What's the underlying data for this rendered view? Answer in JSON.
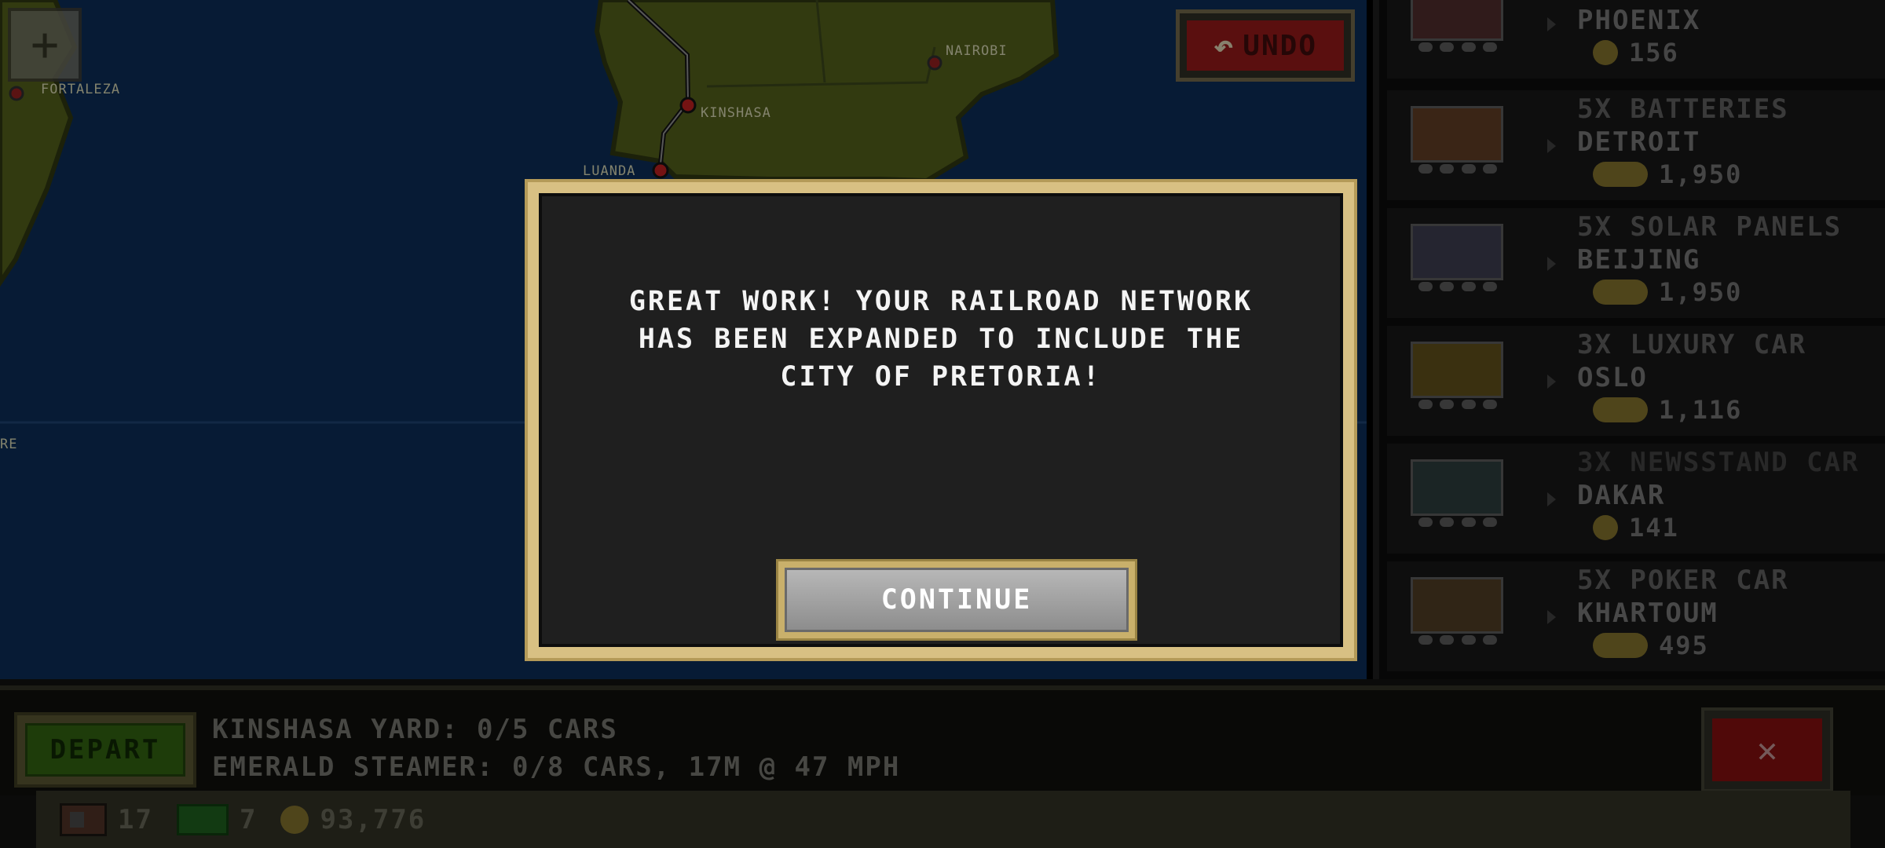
{
  "map": {
    "zoom_label": "+",
    "undo_label": "UNDO",
    "cities": {
      "fortaleza": "FORTALEZA",
      "nairobi": "NAIROBI",
      "kinshasa": "KINSHASA",
      "luanda": "LUANDA",
      "partial": "RE"
    }
  },
  "orders": [
    {
      "qty": "",
      "dest": "PHOENIX",
      "pay": "156",
      "pay_type": "coin"
    },
    {
      "qty": "5X BATTERIES",
      "dest": "DETROIT",
      "pay": "1,950",
      "pay_type": "cash"
    },
    {
      "qty": "5X SOLAR PANELS",
      "dest": "BEIJING",
      "pay": "1,950",
      "pay_type": "cash"
    },
    {
      "qty": "3X LUXURY CAR",
      "dest": "OSLO",
      "pay": "1,116",
      "pay_type": "cash"
    },
    {
      "qty": "3X NEWSSTAND CAR",
      "dest": "DAKAR",
      "pay": "141",
      "pay_type": "coin"
    },
    {
      "qty": "5X POKER CAR",
      "dest": "KHARTOUM",
      "pay": "495",
      "pay_type": "cash"
    }
  ],
  "modal": {
    "message_line1": "GREAT WORK! YOUR RAILROAD NETWORK",
    "message_line2": "HAS BEEN EXPANDED TO INCLUDE THE",
    "message_line3": "CITY OF PRETORIA!",
    "continue_label": "CONTINUE"
  },
  "bottom": {
    "depart_label": "DEPART",
    "status_line1": "KINSHASA YARD: 0/5 CARS",
    "status_line2": "EMERALD STEAMER: 0/8 CARS, 17M @ 47 MPH",
    "close_label": "✕"
  },
  "stats": {
    "tracks": "17",
    "cash": "7",
    "coins": "93,776"
  },
  "colors": {
    "ocean": "#0b2a52",
    "land": "#4e5a1a",
    "modal_border": "#d8c083",
    "modal_bg": "#1f1f1f",
    "depart_green": "#2e5c10",
    "close_red": "#7c0f0f"
  }
}
